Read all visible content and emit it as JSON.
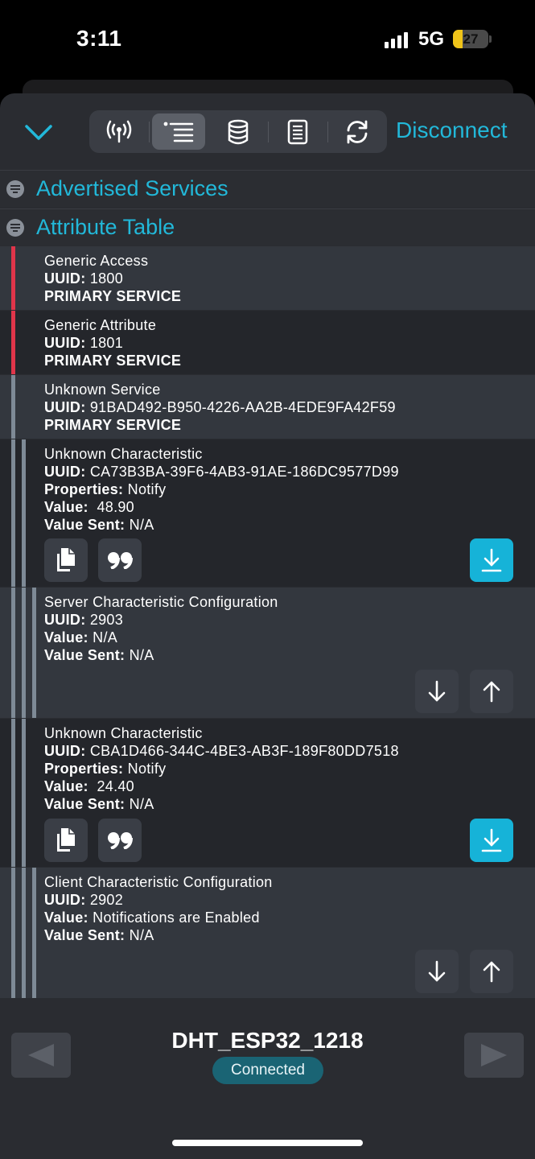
{
  "status_bar": {
    "time": "3:11",
    "network": "5G",
    "battery": "27",
    "battery_level": 0.27,
    "battery_color": "#f0c419"
  },
  "toolbar": {
    "collapse_icon": "chevron-down-icon",
    "tabs": [
      {
        "icon": "antenna-icon",
        "active": false
      },
      {
        "icon": "list-icon",
        "active": true
      },
      {
        "icon": "database-icon",
        "active": false
      },
      {
        "icon": "document-icon",
        "active": false
      },
      {
        "icon": "refresh-icon",
        "active": false
      }
    ],
    "disconnect_label": "Disconnect",
    "accent": "#22b8d9"
  },
  "sections": {
    "advertised": "Advertised Services",
    "attribute_table": "Attribute Table"
  },
  "labels": {
    "uuid": "UUID:",
    "properties": "Properties:",
    "value": "Value:",
    "value_sent": "Value Sent:"
  },
  "attributes": [
    {
      "name": "Generic Access",
      "uuid": "1800",
      "type": "PRIMARY SERVICE",
      "bar_color": "#e0354a"
    },
    {
      "name": "Generic Attribute",
      "uuid": "1801",
      "type": "PRIMARY SERVICE",
      "bar_color": "#e0354a"
    },
    {
      "name": "Unknown Service",
      "uuid": "91BAD492-B950-4226-AA2B-4EDE9FA42F59",
      "type": "PRIMARY SERVICE",
      "bar_color": "#7e8a96"
    },
    {
      "name": "Unknown Characteristic",
      "uuid": "CA73B3BA-39F6-4AB3-91AE-186DC9577D99",
      "properties": "Notify",
      "value": " 48.90",
      "value_sent": "N/A"
    },
    {
      "name": "Server Characteristic Configuration",
      "uuid": "2903",
      "value": "N/A",
      "value_sent": "N/A"
    },
    {
      "name": "Unknown Characteristic",
      "uuid": "CBA1D466-344C-4BE3-AB3F-189F80DD7518",
      "properties": "Notify",
      "value": " 24.40",
      "value_sent": "N/A"
    },
    {
      "name": "Client Characteristic Configuration",
      "uuid": "2902",
      "value": "Notifications are Enabled",
      "value_sent": "N/A"
    }
  ],
  "device": {
    "name": "DHT_ESP32_1218",
    "status": "Connected"
  }
}
